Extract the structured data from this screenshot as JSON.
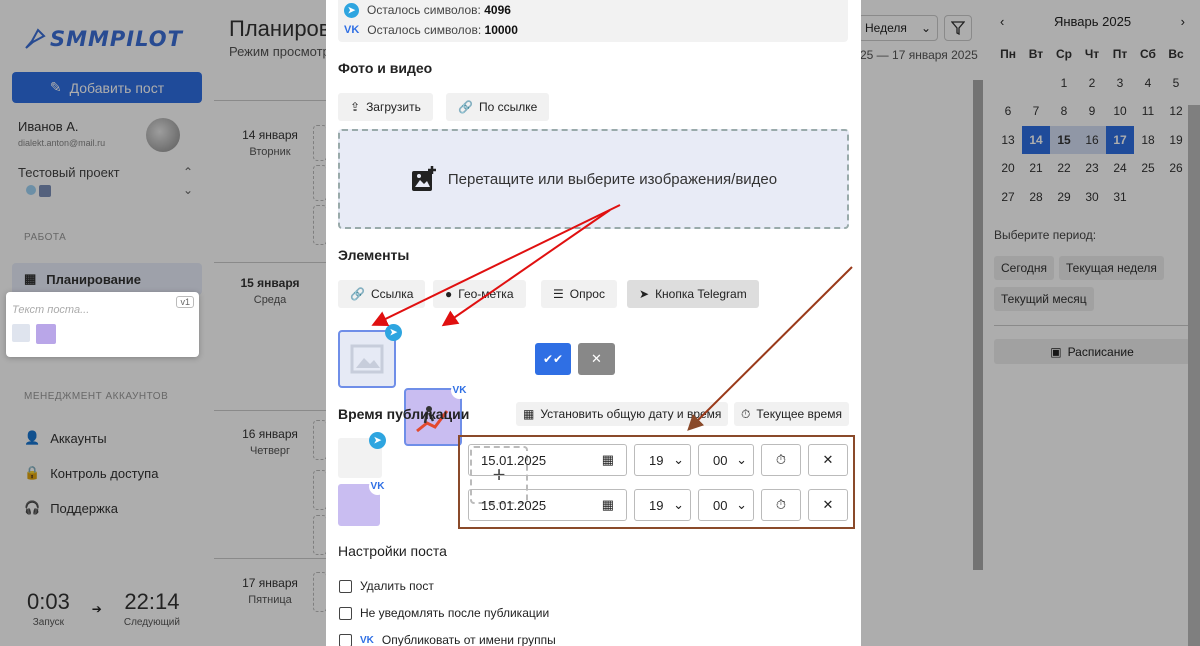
{
  "sidebar": {
    "logo": "SMMPILOT",
    "add_post": "Добавить пост",
    "user_name": "Иванов А.",
    "user_email": "dialekt.anton@mail.ru",
    "project": "Тестовый проект",
    "section_work": "РАБОТА",
    "nav_planning": "Планирование",
    "section_accounts": "МЕНЕДЖМЕНТ АККАУНТОВ",
    "nav_accounts": "Аккаунты",
    "nav_access": "Контроль доступа",
    "nav_support": "Поддержка",
    "post_card": {
      "placeholder": "Текст поста...",
      "version": "v1"
    },
    "timer": {
      "launch_time": "0:03",
      "launch_label": "Запуск",
      "next_time": "22:14",
      "next_label": "Следующий"
    }
  },
  "main": {
    "title": "Планирова",
    "subtitle": "Режим просмотра",
    "view_select": "Неделя",
    "range": "25 — 17 января 2025",
    "days": [
      {
        "date": "14 января",
        "dow": "Вторник"
      },
      {
        "date": "15 января",
        "dow": "Среда"
      },
      {
        "date": "16 января",
        "dow": "Четверг"
      },
      {
        "date": "17 января",
        "dow": "Пятница"
      }
    ]
  },
  "calendar": {
    "month": "Январь 2025",
    "dows": [
      "Пн",
      "Вт",
      "Ср",
      "Чт",
      "Пт",
      "Сб",
      "Вс"
    ],
    "weeks": [
      [
        "",
        "",
        "1",
        "2",
        "3",
        "4",
        "5"
      ],
      [
        "6",
        "7",
        "8",
        "9",
        "10",
        "11",
        "12"
      ],
      [
        "13",
        "14",
        "15",
        "16",
        "17",
        "18",
        "19"
      ],
      [
        "20",
        "21",
        "22",
        "23",
        "24",
        "25",
        "26"
      ],
      [
        "27",
        "28",
        "29",
        "30",
        "31",
        "",
        ""
      ]
    ],
    "period_label": "Выберите период:",
    "today": "Сегодня",
    "current_week": "Текущая неделя",
    "current_month": "Текущий месяц",
    "schedule": "Расписание"
  },
  "modal": {
    "quota_tg_label": "Осталось символов:",
    "quota_tg_value": "4096",
    "quota_vk_label": "Осталось символов:",
    "quota_vk_value": "10000",
    "media_title": "Фото и видео",
    "upload": "Загрузить",
    "by_link": "По ссылке",
    "dropzone_text": "Перетащите или выберите изображения/видео",
    "elements_title": "Элементы",
    "el_link": "Ссылка",
    "el_geo": "Гео-метка",
    "el_poll": "Опрос",
    "el_tg_button": "Кнопка Telegram",
    "add_plus": "+",
    "pub_time_title": "Время публикации",
    "set_common": "Установить общую дату и время",
    "current_time": "Текущее время",
    "rows": [
      {
        "date": "15.01.2025",
        "hour": "19",
        "minute": "00"
      },
      {
        "date": "15.01.2025",
        "hour": "19",
        "minute": "00"
      }
    ],
    "settings_title": "Настройки поста",
    "opt_delete": "Удалить пост",
    "opt_no_notify": "Не уведомлять после публикации",
    "opt_group": "Опубликовать от имени группы"
  },
  "colors": {
    "accent": "#2f6fe4",
    "telegram": "#2ea5e0",
    "annotation": "#e01010",
    "box": "#8a4a2a"
  }
}
